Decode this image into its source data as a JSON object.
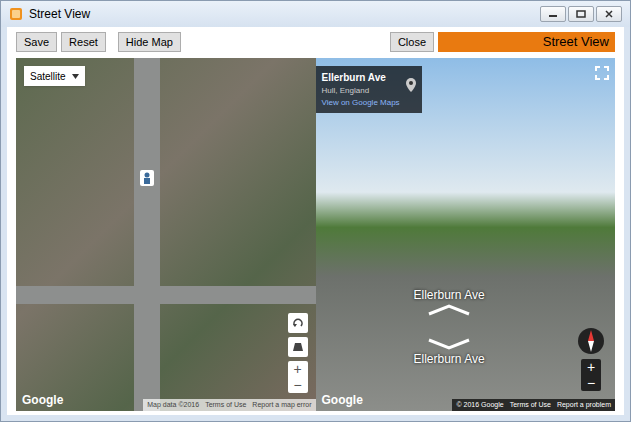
{
  "window": {
    "title": "Street View"
  },
  "toolbar": {
    "buttons": [
      "Save",
      "Reset",
      "Hide Map"
    ],
    "close": "Close",
    "banner": "Street View"
  },
  "map": {
    "type_select": "Satellite",
    "logo": "Google",
    "footer": [
      "Map data ©2016",
      "Terms of Use",
      "Report a map error"
    ],
    "zoom": [
      "+",
      "−"
    ]
  },
  "street_view": {
    "info": {
      "title": "Ellerburn Ave",
      "subtitle": "Hull, England",
      "link": "View on Google Maps"
    },
    "road_labels": [
      "Ellerburn Ave",
      "Ellerburn Ave"
    ],
    "logo": "Google",
    "footer": [
      "© 2016 Google",
      "Terms of Use",
      "Report a problem"
    ],
    "zoom": [
      "+",
      "−"
    ]
  }
}
